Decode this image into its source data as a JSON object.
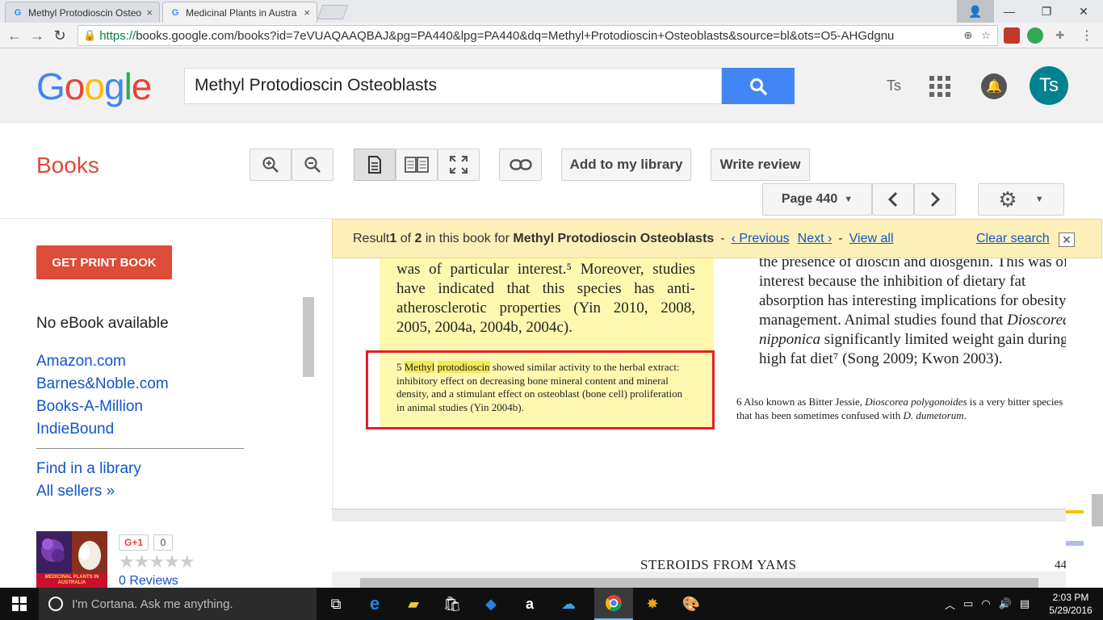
{
  "browser": {
    "tabs": [
      {
        "label": "Methyl Protodioscin Osteo",
        "close": "×"
      },
      {
        "label": "Medicinal Plants in Austra",
        "close": "×"
      }
    ],
    "window_controls": {
      "user": "👤",
      "minimize": "—",
      "restore": "❐",
      "close": "✕"
    },
    "url_scheme": "https://",
    "url_rest": "books.google.com/books?id=7eVUAQAAQBAJ&pg=PA440&lpg=PA440&dq=Methyl+Protodioscin+Osteoblasts&source=bl&ots=O5-AHGdgnu"
  },
  "header": {
    "logo_letters": [
      {
        "ch": "G",
        "color": "#4285f4"
      },
      {
        "ch": "o",
        "color": "#ea4335"
      },
      {
        "ch": "o",
        "color": "#fbbc05"
      },
      {
        "ch": "g",
        "color": "#4285f4"
      },
      {
        "ch": "l",
        "color": "#34a853"
      },
      {
        "ch": "e",
        "color": "#ea4335"
      }
    ],
    "search_query": "Methyl Protodioscin Osteoblasts",
    "user_short": "Ts",
    "avatar_initials": "Ts"
  },
  "books_toolbar": {
    "title": "Books",
    "add_library": "Add to my library",
    "write_review": "Write review",
    "page_label": "Page 440"
  },
  "sidebar": {
    "print_book": "GET PRINT BOOK",
    "no_ebook": "No eBook available",
    "sellers": [
      "Amazon.com",
      "Barnes&Noble.com",
      "Books-A-Million",
      "IndieBound"
    ],
    "find_library": "Find in a library",
    "all_sellers": "All sellers »",
    "cover_caption": "MEDICINAL PLANTS IN AUSTRALIA",
    "gplus": "G+1",
    "gplus_count": "0",
    "stars": "★★★★★",
    "reviews": "0 Reviews"
  },
  "result_bar": {
    "prefix": "Result ",
    "num": "1",
    "of": " of ",
    "total": "2",
    "mid": " in this book for ",
    "query": "Methyl Protodioscin Osteoblasts",
    "dash1": "-",
    "previous": "‹ Previous",
    "next": "Next ›",
    "dash2": "-",
    "view_all": "View all",
    "clear_search": "Clear search",
    "close": "✕"
  },
  "page_content": {
    "left_body": "was of particular interest.⁵ Moreover, studies have indicated that this species has anti-atherosclerotic properties (Yin 2010, 2008, 2005, 2004a, 2004b, 2004c).",
    "left_foot_num": "5",
    "left_foot_hl1": "Methyl",
    "left_foot_hl2": "protodioscin",
    "left_foot_rest": "showed similar activity to the herbal extract: inhibitory effect on decreasing bone mineral content and mineral density, and a stimulant effect on osteoblast (bone cell) proliferation in animal studies (Yin 2004b).",
    "right_body_1": "the presence of dioscin and diosgenin. This was of interest because the inhibition of dietary fat absorption has interesting implications for obesity management. Animal studies found that ",
    "right_body_it1": "Dioscorea nipponica",
    "right_body_2": " significantly limited weight gain during a high fat diet⁷ (Song 2009; Kwon 2003).",
    "right_foot_1": "6  Also known as Bitter Jessie, ",
    "right_foot_it1": "Dioscorea polygonoides",
    "right_foot_2": " is a very bitter species that has been sometimes confused with ",
    "right_foot_it2": "D. dumetorum",
    "right_foot_3": ".",
    "running_head": "STEROIDS FROM YAMS",
    "page_number": "44"
  },
  "taskbar": {
    "cortana": "I'm Cortana. Ask me anything.",
    "time": "2:03 PM",
    "date": "5/29/2016"
  }
}
